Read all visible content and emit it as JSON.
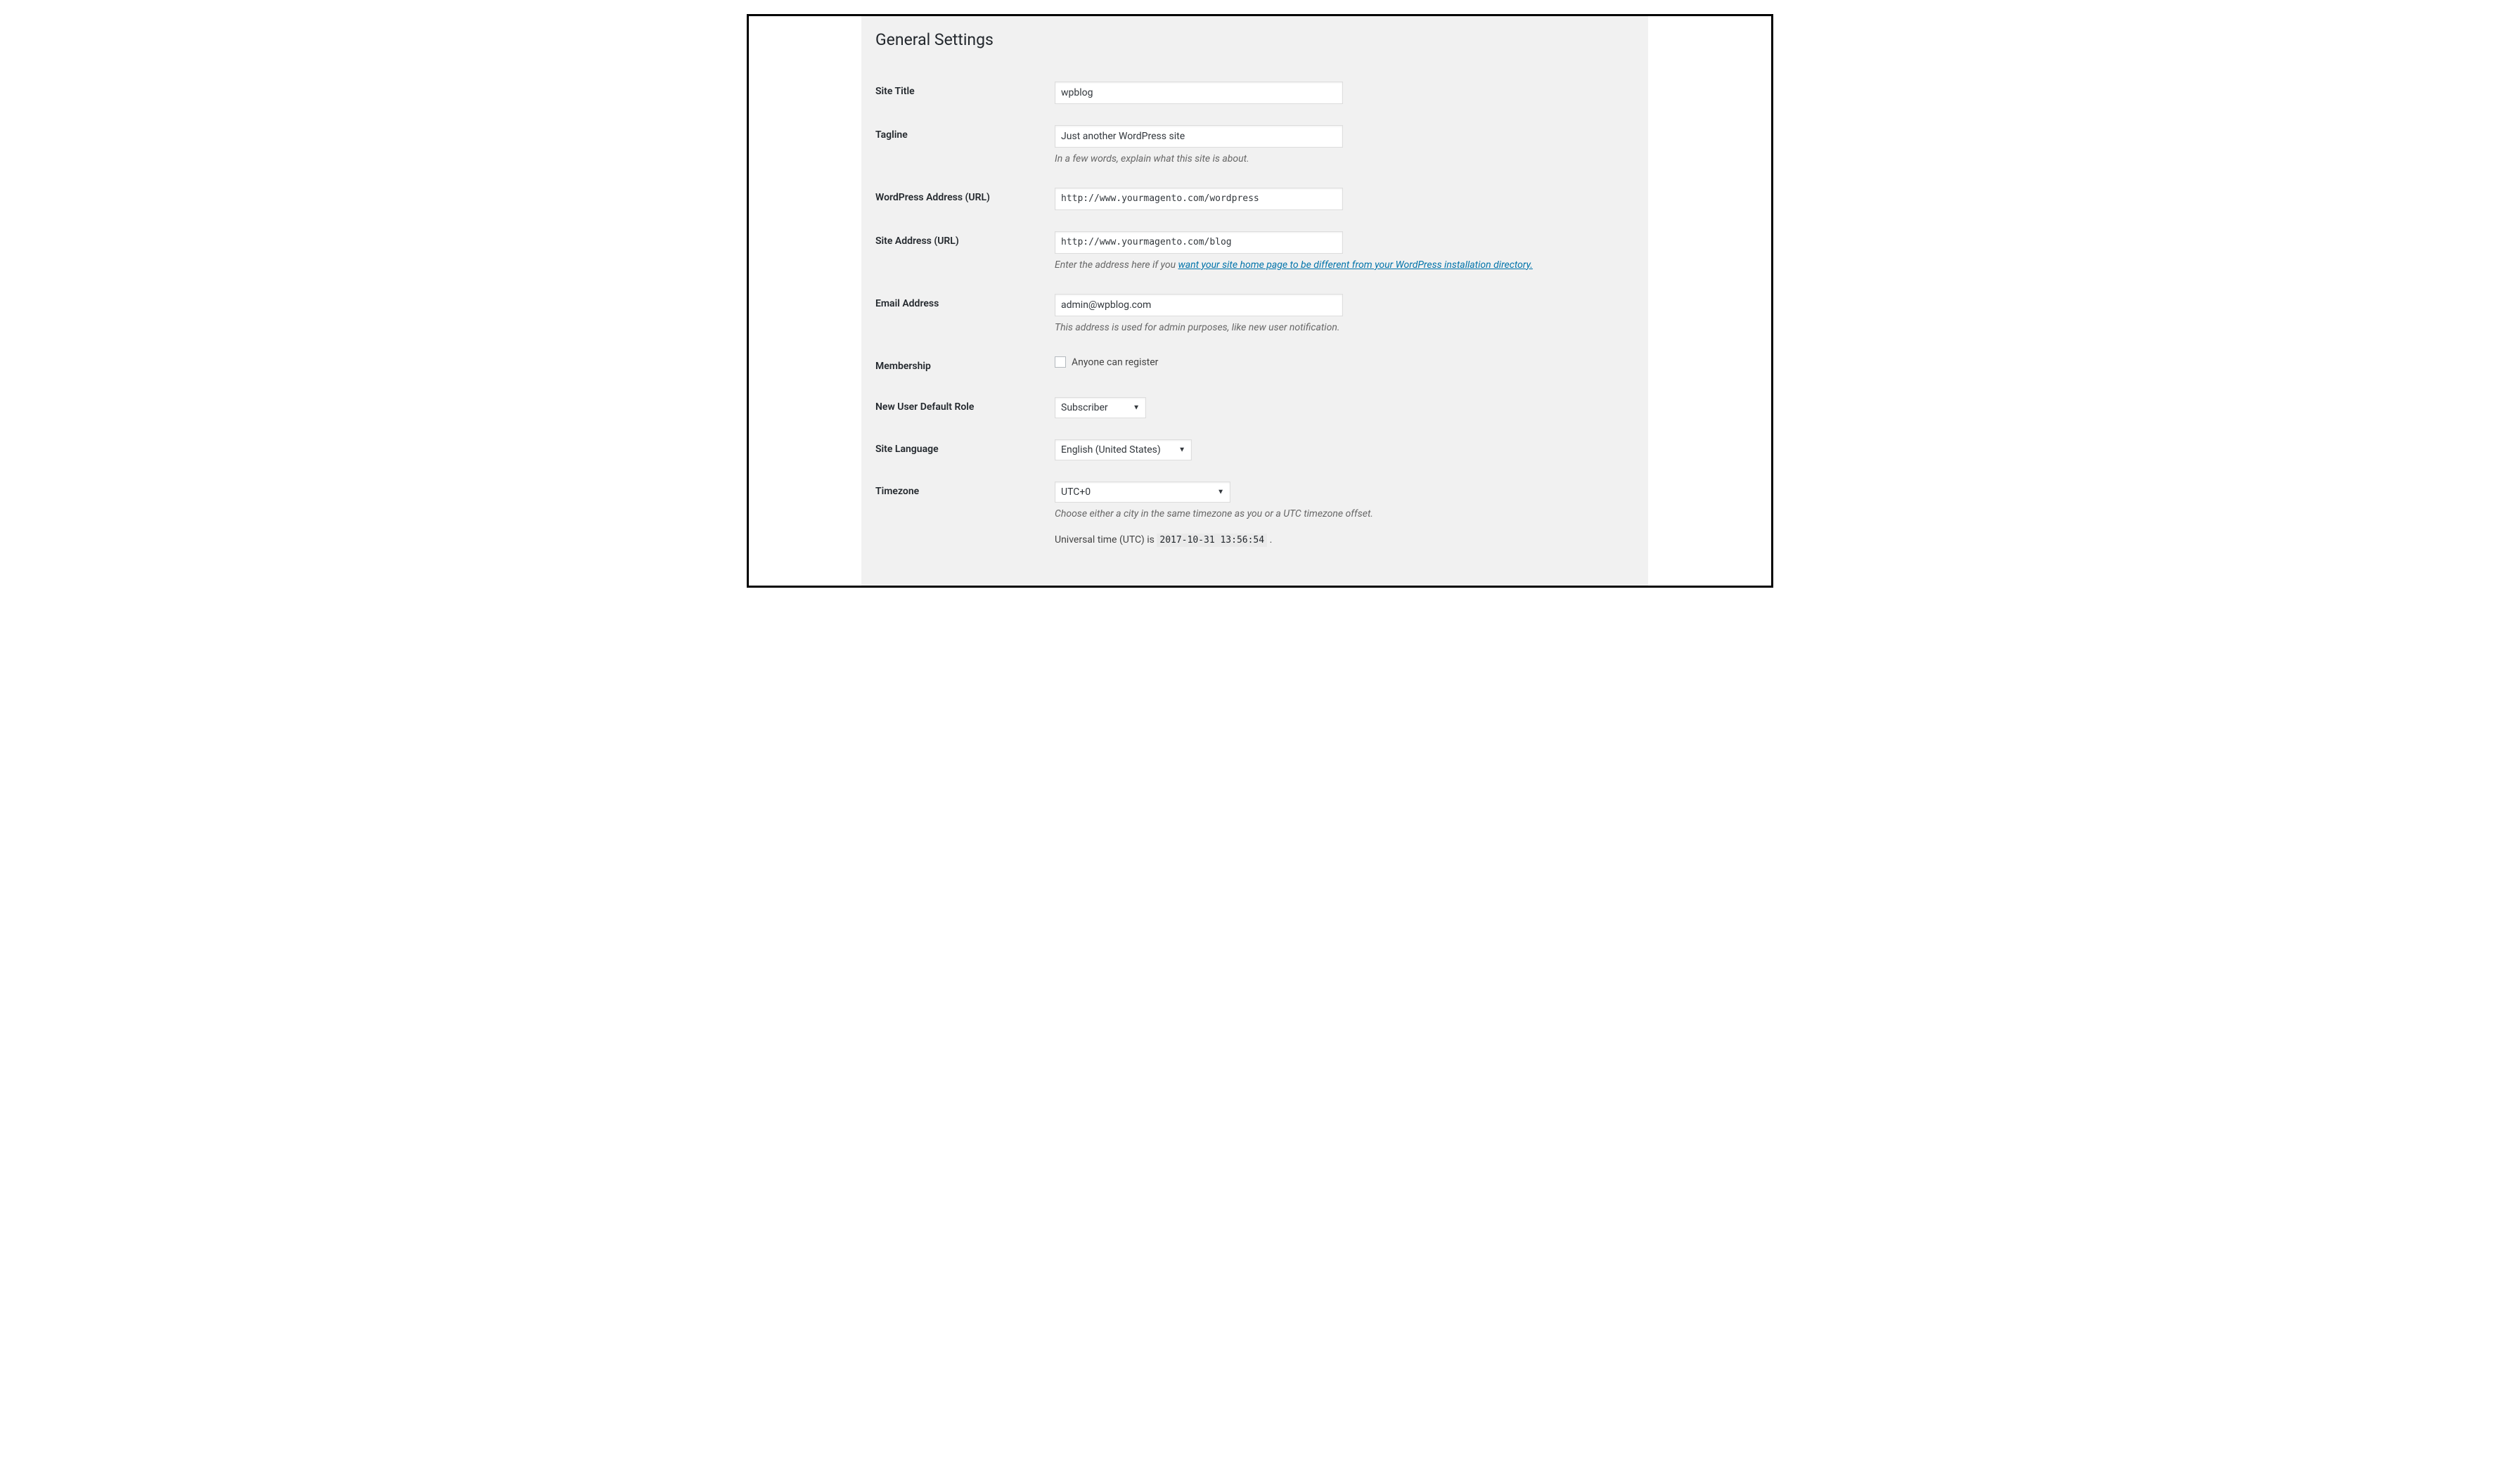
{
  "page": {
    "title": "General Settings"
  },
  "fields": {
    "site_title": {
      "label": "Site Title",
      "value": "wpblog"
    },
    "tagline": {
      "label": "Tagline",
      "value": "Just another WordPress site",
      "description": "In a few words, explain what this site is about."
    },
    "wp_address": {
      "label": "WordPress Address (URL)",
      "value": "http://www.yourmagento.com/wordpress"
    },
    "site_address": {
      "label": "Site Address (URL)",
      "value": "http://www.yourmagento.com/blog",
      "desc_prefix": "Enter the address here if you ",
      "desc_link": "want your site home page to be different from your WordPress installation directory."
    },
    "email": {
      "label": "Email Address",
      "value": "admin@wpblog.com",
      "description": "This address is used for admin purposes, like new user notification."
    },
    "membership": {
      "label": "Membership",
      "checkbox_label": "Anyone can register"
    },
    "default_role": {
      "label": "New User Default Role",
      "value": "Subscriber"
    },
    "site_language": {
      "label": "Site Language",
      "value": "English (United States)"
    },
    "timezone": {
      "label": "Timezone",
      "value": "UTC+0",
      "description": "Choose either a city in the same timezone as you or a UTC timezone offset.",
      "utc_prefix": "Universal time (UTC) is ",
      "utc_value": "2017-10-31 13:56:54",
      "utc_suffix": " ."
    }
  }
}
